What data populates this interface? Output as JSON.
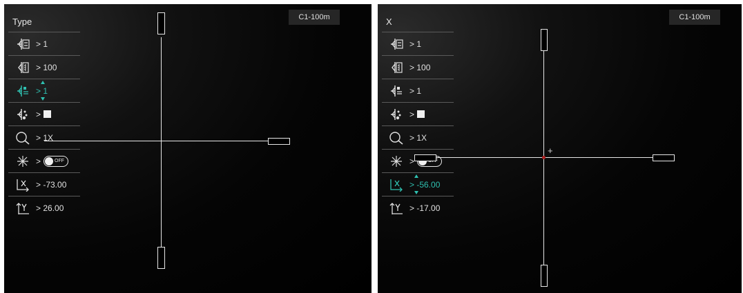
{
  "left_panel": {
    "title": "Type",
    "badge": "C1-100m",
    "rows": [
      {
        "icon": "reticle-type-icon",
        "value": "> 1"
      },
      {
        "icon": "reticle-distance-icon",
        "value": "> 100"
      },
      {
        "icon": "reticle-style-icon",
        "value": "> 1",
        "active": true
      },
      {
        "icon": "reticle-color-icon",
        "value": ">"
      },
      {
        "icon": "zoom-icon",
        "value": "> 1X"
      },
      {
        "icon": "freeze-icon",
        "value": ">",
        "toggle": "OFF"
      },
      {
        "icon": "x-axis-icon",
        "value": "> -73.00"
      },
      {
        "icon": "y-axis-icon",
        "value": "> 26.00"
      }
    ]
  },
  "right_panel": {
    "title": "X",
    "badge": "C1-100m",
    "rows": [
      {
        "icon": "reticle-type-icon",
        "value": "> 1"
      },
      {
        "icon": "reticle-distance-icon",
        "value": "> 100"
      },
      {
        "icon": "reticle-style-icon",
        "value": "> 1"
      },
      {
        "icon": "reticle-color-icon",
        "value": ">"
      },
      {
        "icon": "zoom-icon",
        "value": "> 1X"
      },
      {
        "icon": "freeze-icon",
        "value": ">",
        "toggle": "OFF"
      },
      {
        "icon": "x-axis-icon",
        "value": "> -56.00",
        "active": true
      },
      {
        "icon": "y-axis-icon",
        "value": "> -17.00"
      }
    ]
  },
  "colors": {
    "accent": "#2fc0b0",
    "reticle": "#e8e8e8",
    "center_dot": "#b02020"
  }
}
